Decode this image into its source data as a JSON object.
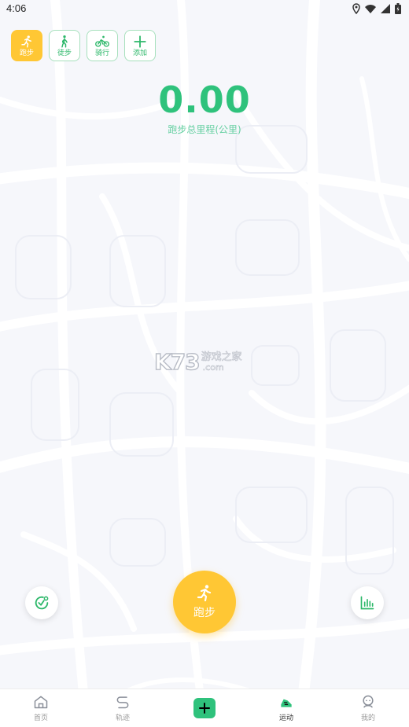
{
  "status_bar": {
    "time": "4:06"
  },
  "modes": [
    {
      "label": "跑步",
      "icon": "running-icon",
      "active": true
    },
    {
      "label": "徒步",
      "icon": "walking-icon",
      "active": false
    },
    {
      "label": "骑行",
      "icon": "cycling-icon",
      "active": false
    },
    {
      "label": "添加",
      "icon": "plus-icon",
      "active": false
    }
  ],
  "distance": {
    "value": "0.00",
    "label": "跑步总里程(公里)"
  },
  "watermark": {
    "logo": "K73",
    "name": "游戏之家",
    "domain": ".com"
  },
  "start_button": {
    "label": "跑步"
  },
  "bottom_nav": [
    {
      "label": "首页",
      "icon": "home-icon"
    },
    {
      "label": "轨迹",
      "icon": "track-icon"
    },
    {
      "label": "",
      "icon": "plus-icon"
    },
    {
      "label": "运动",
      "icon": "sport-icon",
      "active": true
    },
    {
      "label": "我的",
      "icon": "profile-icon"
    }
  ],
  "colors": {
    "accent_green": "#2fc27c",
    "accent_yellow": "#ffc734"
  }
}
